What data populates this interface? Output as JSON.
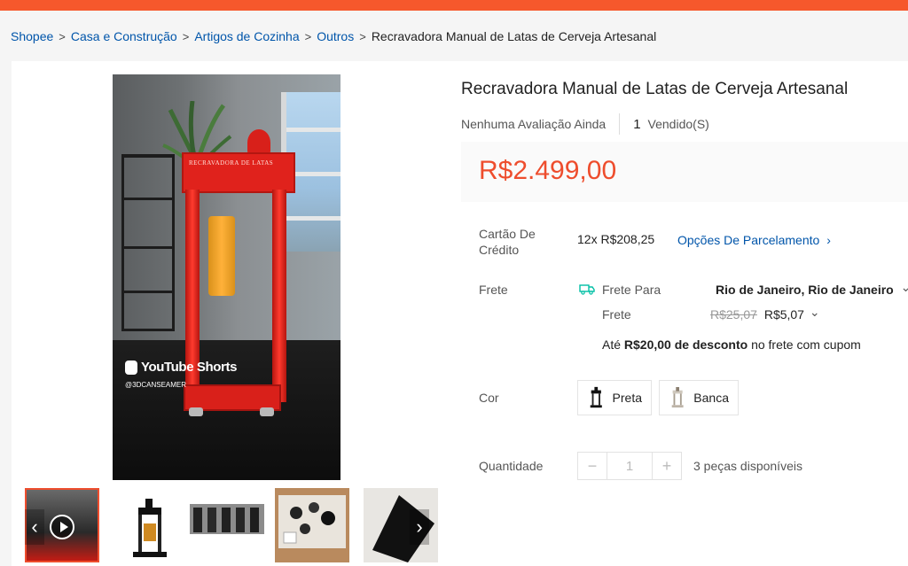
{
  "colors": {
    "accent": "#ee4d2d",
    "link": "#0055aa",
    "topbar": "#f6582c"
  },
  "breadcrumb": {
    "items": [
      "Shopee",
      "Casa e Construção",
      "Artigos de Cozinha",
      "Outros"
    ],
    "current": "Recravadora Manual de Latas de Cerveja Artesanal",
    "separator": ">"
  },
  "product": {
    "title": "Recravadora Manual de Latas de Cerveja Artesanal",
    "rating_text": "Nenhuma Avaliação Ainda",
    "sold_count": "1",
    "sold_label": "Vendido(S)",
    "price": "R$2.499,00"
  },
  "media": {
    "watermark": "YouTube Shorts",
    "handle": "@3DCANSEAMER",
    "machine_label": "RECRAVADORA DE LATAS",
    "thumb_arrow_left": "‹",
    "thumb_arrow_right": "›"
  },
  "credit": {
    "label": "Cartão De Crédito",
    "installments": "12x R$208,25",
    "link": "Opções De Parcelamento",
    "link_icon": "chevron-right-icon"
  },
  "shipping": {
    "label": "Frete",
    "to_label": "Frete Para",
    "destination": "Rio de Janeiro, Rio de Janeiro",
    "cost_label": "Frete",
    "old_price": "R$25,07",
    "new_price": "R$5,07",
    "discount_prefix": "Até ",
    "discount_amount": "R$20,00 de desconto",
    "discount_suffix": " no frete com cupom",
    "truck_icon": "truck-icon",
    "chevron": "⌄"
  },
  "color": {
    "label": "Cor",
    "options": [
      "Preta",
      "Banca"
    ]
  },
  "quantity": {
    "label": "Quantidade",
    "minus": "−",
    "value": "1",
    "plus": "+",
    "available": "3 peças disponíveis"
  }
}
